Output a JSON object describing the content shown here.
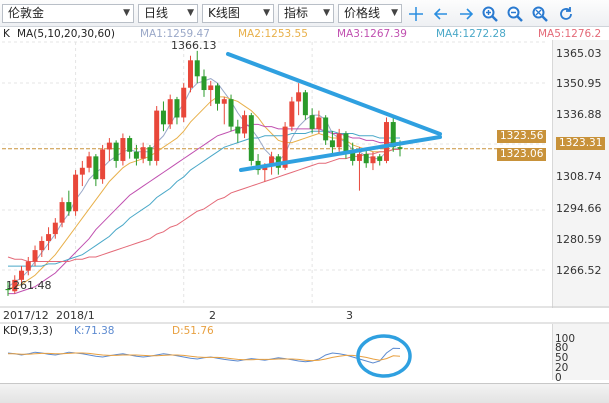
{
  "toolbar": {
    "symbol": "伦敦金",
    "period": "日线",
    "chart_style": "K线图",
    "indicator": "指标",
    "price_line": "价格线",
    "icons": [
      "crosshair-icon",
      "arrow-left-icon",
      "arrow-right-icon",
      "zoom-in-icon",
      "zoom-out-icon",
      "zoom-reset-icon",
      "refresh-icon"
    ]
  },
  "ma_header": {
    "k_label": "K",
    "ma_params": "MA(5,10,20,30,60)",
    "ma1": "MA1:1259.47",
    "ma2": "MA2:1253.55",
    "ma3": "MA3:1267.39",
    "ma4": "MA4:1272.28",
    "ma5": "MA5:1276.2"
  },
  "kd_header": {
    "params": "KD(9,3,3)",
    "k": "K:71.38",
    "d": "D:51.76"
  },
  "colors": {
    "up": "#e8473a",
    "down": "#2a9a2a",
    "ma1": "#9aa8c8",
    "ma2": "#e8b04a",
    "ma3": "#c050b0",
    "ma4": "#4aa8c8",
    "ma5": "#e46a78",
    "k_line": "#5c8ad0",
    "d_line": "#e8a040",
    "annotation": "#2fa0e0",
    "tag": "#c8923a"
  },
  "chart_data": {
    "type": "candlestick",
    "ylim": [
      1255,
      1370
    ],
    "y_ticks": [
      "1365.03",
      "1350.95",
      "1336.88",
      "1323.31",
      "1308.74",
      "1294.66",
      "1280.59",
      "1266.52"
    ],
    "x_labels": [
      "2017/12",
      "2018/1",
      "2",
      "3"
    ],
    "annotations": {
      "high_label": "1366.13",
      "low_label": "1261.48",
      "tag_upper": "1323.56",
      "tag_current": "1323.31",
      "tag_lower": "1323.06"
    },
    "candles": [
      [
        1262,
        1265,
        1259,
        1261.5
      ],
      [
        1261,
        1268,
        1260,
        1266
      ],
      [
        1266,
        1272,
        1264,
        1270
      ],
      [
        1270,
        1276,
        1268,
        1274
      ],
      [
        1274,
        1281,
        1272,
        1279
      ],
      [
        1279,
        1285,
        1276,
        1283
      ],
      [
        1283,
        1289,
        1279,
        1286
      ],
      [
        1286,
        1293,
        1284,
        1291
      ],
      [
        1291,
        1302,
        1289,
        1300
      ],
      [
        1300,
        1305,
        1294,
        1296
      ],
      [
        1296,
        1314,
        1294,
        1312
      ],
      [
        1312,
        1318,
        1307,
        1315
      ],
      [
        1315,
        1322,
        1313,
        1320
      ],
      [
        1320,
        1321,
        1307,
        1310
      ],
      [
        1310,
        1325,
        1308,
        1323
      ],
      [
        1323,
        1328,
        1318,
        1326
      ],
      [
        1326,
        1327,
        1315,
        1318
      ],
      [
        1318,
        1330,
        1316,
        1328
      ],
      [
        1328,
        1329,
        1319,
        1322
      ],
      [
        1322,
        1325,
        1316,
        1319
      ],
      [
        1319,
        1326,
        1317,
        1324
      ],
      [
        1324,
        1325,
        1316,
        1318
      ],
      [
        1318,
        1342,
        1316,
        1340
      ],
      [
        1340,
        1344,
        1331,
        1334
      ],
      [
        1334,
        1347,
        1332,
        1345
      ],
      [
        1345,
        1346,
        1334,
        1337
      ],
      [
        1337,
        1352,
        1335,
        1350
      ],
      [
        1350,
        1364,
        1348,
        1362
      ],
      [
        1362,
        1366.13,
        1352,
        1355
      ],
      [
        1355,
        1358,
        1346,
        1349
      ],
      [
        1349,
        1353,
        1342,
        1351
      ],
      [
        1351,
        1352,
        1340,
        1343
      ],
      [
        1343,
        1346,
        1334,
        1345
      ],
      [
        1345,
        1347,
        1331,
        1333
      ],
      [
        1333,
        1336,
        1326,
        1330
      ],
      [
        1330,
        1340,
        1328,
        1338
      ],
      [
        1338,
        1339,
        1316,
        1318
      ],
      [
        1318,
        1321,
        1312,
        1314
      ],
      [
        1314,
        1317,
        1309,
        1316
      ],
      [
        1316,
        1322,
        1312,
        1320
      ],
      [
        1320,
        1321,
        1312,
        1315
      ],
      [
        1315,
        1335,
        1314,
        1333
      ],
      [
        1333,
        1346,
        1331,
        1344
      ],
      [
        1344,
        1352,
        1338,
        1348
      ],
      [
        1348,
        1349,
        1336,
        1338
      ],
      [
        1338,
        1341,
        1330,
        1332
      ],
      [
        1332,
        1340,
        1330,
        1337
      ],
      [
        1337,
        1338,
        1325,
        1327
      ],
      [
        1327,
        1331,
        1321,
        1324
      ],
      [
        1324,
        1332,
        1322,
        1330
      ],
      [
        1330,
        1331,
        1319,
        1322
      ],
      [
        1322,
        1326,
        1316,
        1318
      ],
      [
        1318,
        1324,
        1305,
        1321
      ],
      [
        1321,
        1323,
        1315,
        1317
      ],
      [
        1317,
        1322,
        1314,
        1320
      ],
      [
        1320,
        1321,
        1316,
        1318
      ],
      [
        1318,
        1337,
        1317,
        1335
      ],
      [
        1335,
        1337,
        1322,
        1324
      ],
      [
        1324,
        1327,
        1320,
        1323.3
      ]
    ],
    "ma_series": [
      {
        "name": "MA1",
        "values": [
          1263,
          1265,
          1267,
          1270,
          1274,
          1278,
          1282,
          1286,
          1291,
          1295,
          1301,
          1305,
          1310,
          1313,
          1315,
          1318,
          1320,
          1322,
          1323,
          1322,
          1322,
          1322,
          1326,
          1329,
          1334,
          1339,
          1343,
          1349,
          1352,
          1353,
          1354,
          1352,
          1348,
          1344,
          1339,
          1335,
          1332,
          1328,
          1323,
          1320,
          1318,
          1321,
          1328,
          1333,
          1336,
          1338,
          1338,
          1336,
          1330,
          1328,
          1326,
          1323,
          1322,
          1320,
          1319,
          1319,
          1322,
          1323,
          1324
        ]
      },
      {
        "name": "MA2",
        "values": [
          1262,
          1263,
          1264,
          1266,
          1268,
          1271,
          1274,
          1277,
          1281,
          1285,
          1289,
          1293,
          1297,
          1301,
          1305,
          1309,
          1312,
          1315,
          1317,
          1318,
          1319,
          1320,
          1322,
          1324,
          1326,
          1328,
          1331,
          1335,
          1338,
          1341,
          1344,
          1346,
          1346,
          1345,
          1344,
          1342,
          1340,
          1337,
          1333,
          1330,
          1327,
          1326,
          1326,
          1327,
          1328,
          1329,
          1330,
          1329,
          1328,
          1328,
          1327,
          1325,
          1324,
          1323,
          1322,
          1322,
          1322,
          1323,
          1323
        ]
      },
      {
        "name": "MA3",
        "values": [
          1260,
          1260,
          1261,
          1262,
          1263,
          1265,
          1267,
          1269,
          1272,
          1275,
          1278,
          1281,
          1284,
          1288,
          1291,
          1294,
          1297,
          1300,
          1303,
          1305,
          1307,
          1309,
          1311,
          1313,
          1315,
          1317,
          1319,
          1321,
          1323,
          1325,
          1327,
          1329,
          1330,
          1331,
          1332,
          1333,
          1334,
          1334,
          1333,
          1333,
          1332,
          1332,
          1332,
          1332,
          1332,
          1332,
          1332,
          1331,
          1330,
          1330,
          1329,
          1328,
          1328,
          1327,
          1327,
          1326,
          1326,
          1326,
          1326
        ]
      },
      {
        "name": "MA4",
        "values": [
          1272,
          1272,
          1272,
          1272,
          1272,
          1272,
          1273,
          1273,
          1274,
          1275,
          1276,
          1277,
          1279,
          1281,
          1283,
          1285,
          1288,
          1290,
          1293,
          1295,
          1297,
          1299,
          1302,
          1304,
          1306,
          1309,
          1311,
          1314,
          1316,
          1318,
          1320,
          1322,
          1324,
          1325,
          1326,
          1327,
          1328,
          1328,
          1329,
          1329,
          1329,
          1329,
          1330,
          1330,
          1330,
          1331,
          1331,
          1331,
          1331,
          1330,
          1330,
          1330,
          1329,
          1329,
          1329,
          1328,
          1328,
          1328,
          1328
        ]
      },
      {
        "name": "MA5",
        "values": [
          1276,
          1275,
          1275,
          1274,
          1274,
          1274,
          1274,
          1274,
          1274,
          1274,
          1275,
          1275,
          1276,
          1276,
          1277,
          1278,
          1279,
          1280,
          1281,
          1282,
          1283,
          1284,
          1286,
          1287,
          1289,
          1290,
          1292,
          1294,
          1296,
          1297,
          1299,
          1301,
          1302,
          1304,
          1305,
          1306,
          1307,
          1308,
          1309,
          1310,
          1311,
          1312,
          1313,
          1314,
          1315,
          1316,
          1317,
          1317,
          1318,
          1319,
          1319,
          1320,
          1320,
          1321,
          1321,
          1322,
          1322,
          1323,
          1323
        ]
      }
    ],
    "kd_ylim": [
      0,
      100
    ],
    "kd_ticks": [
      "100",
      "80",
      "50",
      "20",
      "0"
    ],
    "kd_series": [
      {
        "name": "K",
        "values": [
          60,
          58,
          55,
          58,
          62,
          60,
          57,
          55,
          58,
          62,
          60,
          58,
          55,
          52,
          50,
          53,
          56,
          58,
          55,
          52,
          50,
          52,
          55,
          58,
          56,
          53,
          50,
          47,
          45,
          48,
          50,
          47,
          44,
          42,
          40,
          43,
          46,
          44,
          42,
          45,
          48,
          46,
          43,
          40,
          38,
          40,
          45,
          55,
          60,
          58,
          55,
          50,
          45,
          40,
          35,
          40,
          60,
          72,
          71.38
        ]
      },
      {
        "name": "D",
        "values": [
          58,
          58,
          57,
          57,
          58,
          59,
          59,
          58,
          58,
          59,
          60,
          60,
          59,
          57,
          55,
          54,
          54,
          55,
          55,
          55,
          54,
          53,
          53,
          54,
          55,
          55,
          54,
          52,
          50,
          49,
          49,
          49,
          48,
          46,
          44,
          43,
          43,
          44,
          44,
          44,
          45,
          45,
          45,
          44,
          42,
          41,
          42,
          45,
          49,
          52,
          54,
          54,
          52,
          49,
          45,
          42,
          46,
          53,
          51.76
        ]
      }
    ]
  }
}
